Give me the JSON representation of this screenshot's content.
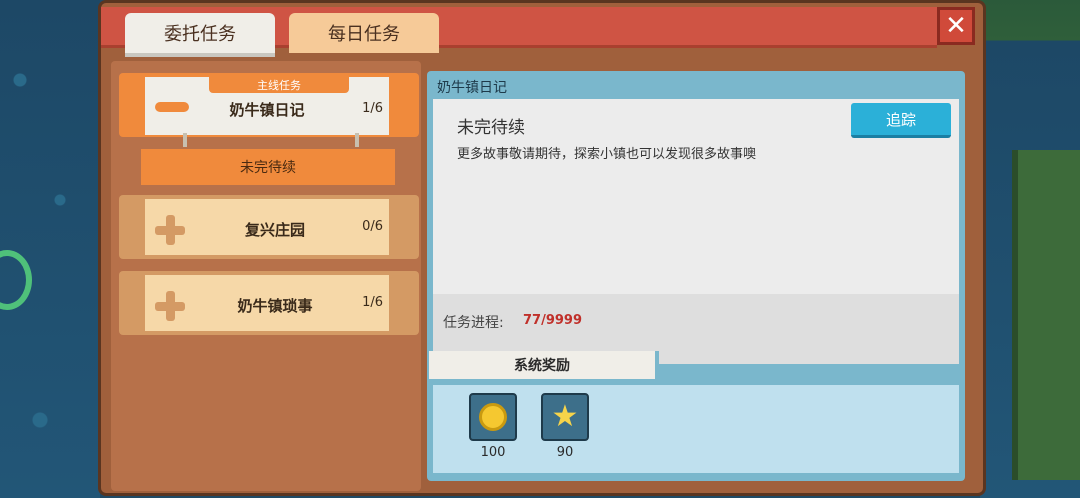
{
  "tabs": [
    {
      "label": "委托任务"
    },
    {
      "label": "每日任务"
    }
  ],
  "close_label": "✕",
  "quests": [
    {
      "tag": "主线任务",
      "title": "奶牛镇日记",
      "count": "1/6",
      "status": "未完待续"
    },
    {
      "title": "复兴庄园",
      "count": "0/6"
    },
    {
      "title": "奶牛镇琐事",
      "count": "1/6"
    }
  ],
  "detail": {
    "title": "奶牛镇日记",
    "status": "未完待续",
    "description": "更多故事敬请期待，探索小镇也可以发现很多故事噢",
    "track_label": "追踪",
    "progress_label": "任务进程:",
    "progress_value": "77/9999",
    "reward_label": "系统奖励",
    "rewards": [
      {
        "icon": "coin-icon",
        "value": "100"
      },
      {
        "icon": "star-icon",
        "value": "90"
      }
    ]
  }
}
